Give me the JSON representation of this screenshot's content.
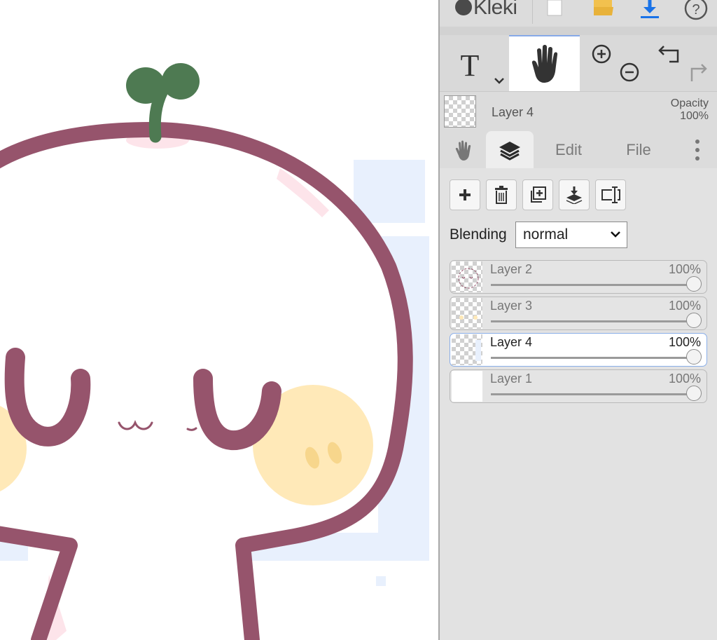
{
  "app": {
    "name": "Kleki"
  },
  "topbar": {
    "icons": [
      "new-image-icon",
      "open-folder-icon",
      "download-icon",
      "help-icon"
    ]
  },
  "tools": {
    "items": [
      "text-tool-icon",
      "hand-tool-icon",
      "zoom-in-icon",
      "zoom-out-icon",
      "undo-icon",
      "redo-icon"
    ],
    "active": "hand-tool-icon"
  },
  "current_layer": {
    "name": "Layer 4",
    "opacity_label": "Opacity",
    "opacity_value": "100%"
  },
  "tabs": [
    {
      "label": "",
      "icon": "hand-icon"
    },
    {
      "label": "",
      "icon": "layers-icon",
      "active": true
    },
    {
      "label": "Edit"
    },
    {
      "label": "File"
    },
    {
      "label": "",
      "icon": "more-vertical-icon"
    }
  ],
  "layer_actions": [
    "add-layer-icon",
    "delete-layer-icon",
    "duplicate-layer-icon",
    "merge-down-icon",
    "rename-layer-icon"
  ],
  "blending": {
    "label": "Blending",
    "value": "normal"
  },
  "layers": [
    {
      "name": "Layer 2",
      "opacity": "100%",
      "opacity_fraction": 1.0,
      "selected": false
    },
    {
      "name": "Layer 3",
      "opacity": "100%",
      "opacity_fraction": 1.0,
      "selected": false
    },
    {
      "name": "Layer 4",
      "opacity": "100%",
      "opacity_fraction": 1.0,
      "selected": true
    },
    {
      "name": "Layer 1",
      "opacity": "100%",
      "opacity_fraction": 1.0,
      "selected": false
    }
  ],
  "colors": {
    "outline": "#96546c",
    "sprout": "#4e7a52",
    "cheek": "#ffe9b8",
    "cheek_dots": "#f7d68c",
    "blush": "#fde4ea",
    "bg_shape": "#e8f0fd",
    "accent": "#87a9e8"
  }
}
